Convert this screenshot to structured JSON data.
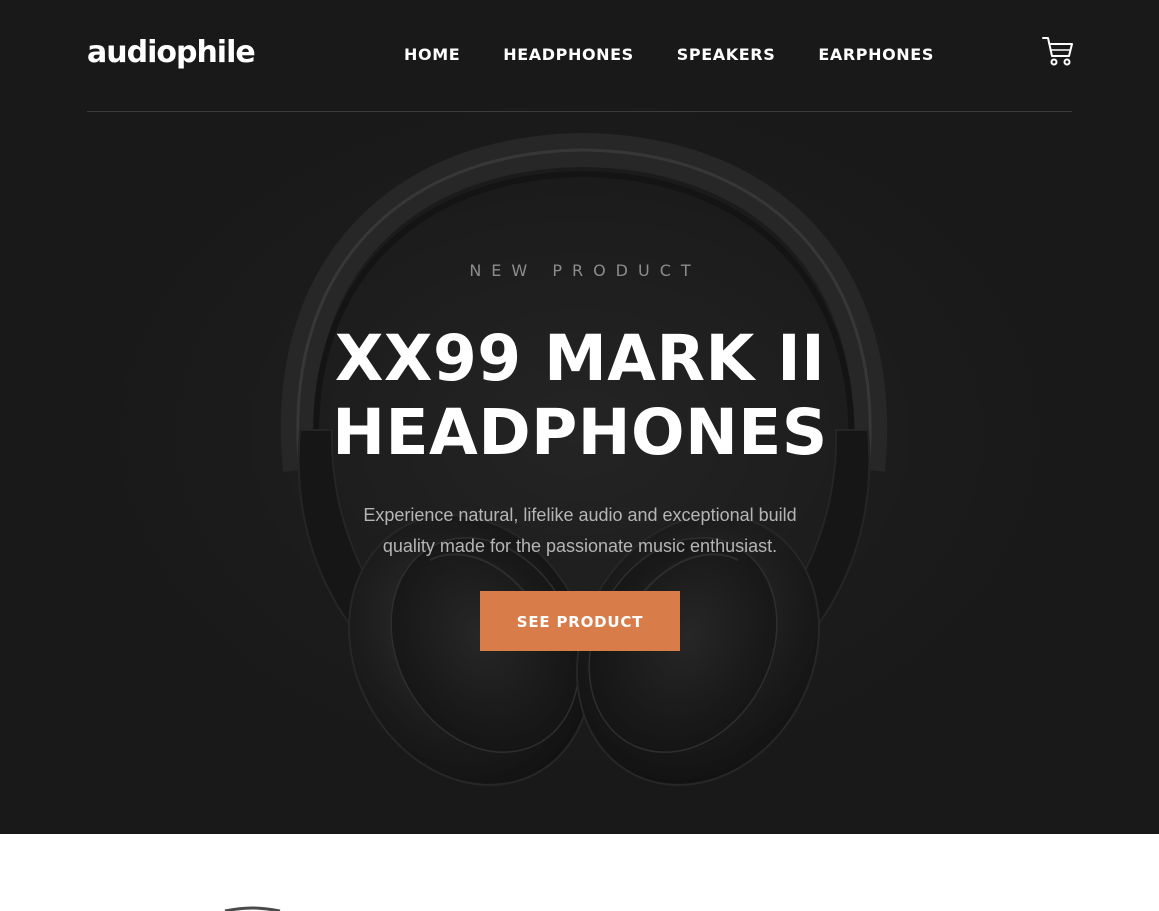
{
  "header": {
    "logo": "audiophile",
    "nav": [
      {
        "label": "HOME"
      },
      {
        "label": "HEADPHONES"
      },
      {
        "label": "SPEAKERS"
      },
      {
        "label": "EARPHONES"
      }
    ],
    "cart_icon": "cart-icon"
  },
  "hero": {
    "overline": "NEW PRODUCT",
    "title_line1": "XX99 MARK II",
    "title_line2": "HEADPHONES",
    "description": "Experience natural, lifelike audio and exceptional build quality made for the passionate music enthusiast.",
    "cta_label": "SEE PRODUCT",
    "image": "headphones-image"
  },
  "colors": {
    "hero_background": "#191919",
    "accent": "#d87d4a",
    "text_light": "#ffffff",
    "text_muted": "#b5b5b5"
  }
}
